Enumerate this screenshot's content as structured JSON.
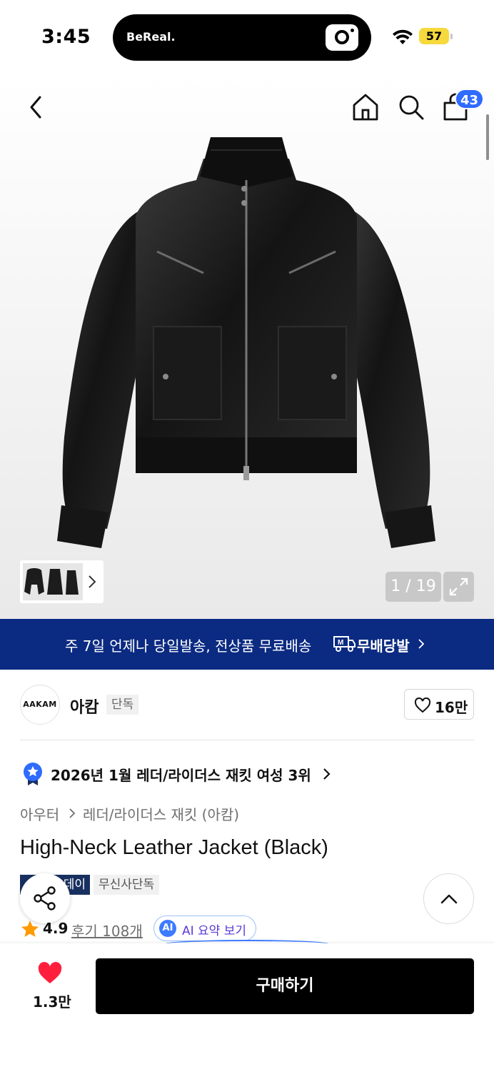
{
  "status_bar": {
    "time": "3:45",
    "island_app": "BeReal.",
    "battery": "57"
  },
  "header": {
    "cart_count": "43"
  },
  "gallery": {
    "counter": "1 / 19"
  },
  "banner": {
    "text": "주 7일 언제나 당일발송, 전상품 무료배송",
    "brand": "무배당발"
  },
  "brand": {
    "logo_text": "AAKAM",
    "name": "아캄",
    "tag": "단독",
    "likes": "16만"
  },
  "ranking": {
    "text": "2026년 1월 레더/라이더스 재킷 여성 3위"
  },
  "category": {
    "level1": "아우터",
    "level2": "레더/라이더스 재킷 (아캄)"
  },
  "product": {
    "title": "High-Neck Leather Jacket (Black)",
    "badge_dark": "데이",
    "badge_light": "무신사단독",
    "rating": "4.9",
    "reviews": "후기 108개",
    "ai_badge": "AI",
    "ai_summary": "AI 요약 보기"
  },
  "bottom": {
    "hearts": "1.3만",
    "buy_label": "구매하기"
  },
  "colors": {
    "banner_bg": "#0b2a82",
    "badge_blue": "#2f6bff",
    "heart_red": "#ff1f3d",
    "star_orange": "#ff9a00"
  }
}
